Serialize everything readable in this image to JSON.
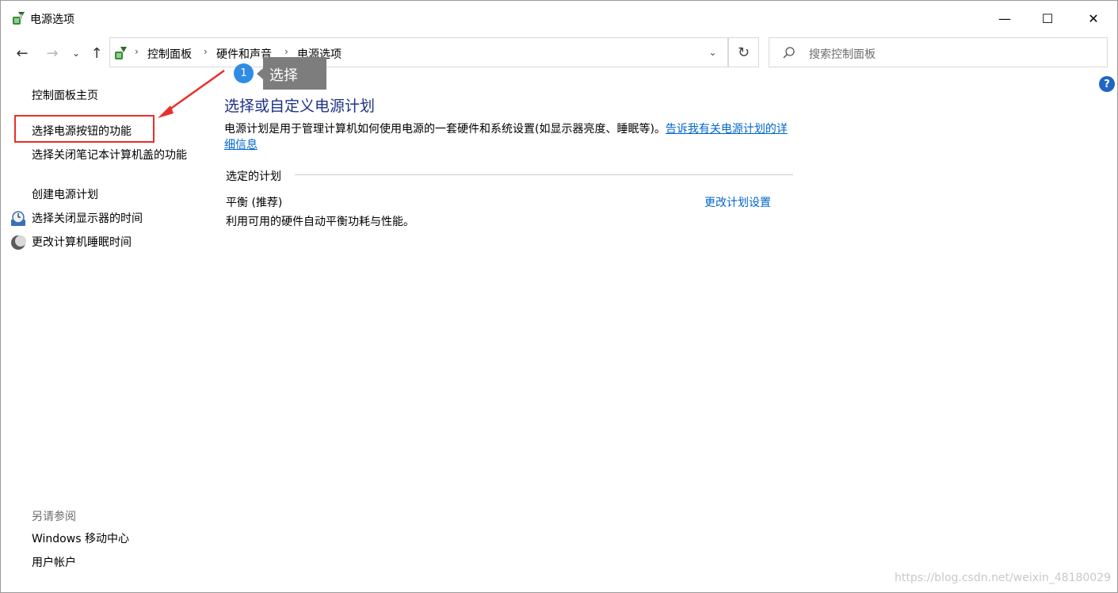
{
  "window": {
    "title": "电源选项",
    "minimize": "—",
    "maximize": "☐",
    "close": "✕"
  },
  "nav": {
    "back": "←",
    "forward": "→",
    "recent": "⌄",
    "up": "↑",
    "breadcrumbs": [
      "控制面板",
      "硬件和声音",
      "电源选项"
    ],
    "separator": "›",
    "dropdown": "⌄",
    "refresh": "↻"
  },
  "search": {
    "placeholder": "搜索控制面板"
  },
  "help": "?",
  "sidebar": {
    "home": "控制面板主页",
    "items": [
      "选择电源按钮的功能",
      "选择关闭笔记本计算机盖的功能",
      "创建电源计划",
      "选择关闭显示器的时间",
      "更改计算机睡眠时间"
    ],
    "see_also_label": "另请参阅",
    "see_also_items": [
      "Windows 移动中心",
      "用户帐户"
    ]
  },
  "annotation": {
    "step_number": "1",
    "step_text": "选择",
    "highlight_color": "#e8302a"
  },
  "main": {
    "title": "选择或自定义电源计划",
    "description": "电源计划是用于管理计算机如何使用电源的一套硬件和系统设置(如显示器亮度、睡眠等)。",
    "description_link": "告诉我有关电源计划的详细信息",
    "section_label": "选定的计划",
    "plan_name": "平衡 (推荐)",
    "plan_description": "利用可用的硬件自动平衡功耗与性能。",
    "plan_link": "更改计划设置"
  },
  "watermark": "https://blog.csdn.net/weixin_48180029",
  "colors": {
    "title_blue": "#1e3287",
    "link_blue": "#0066cc",
    "badge_blue": "#2f8ce5"
  }
}
